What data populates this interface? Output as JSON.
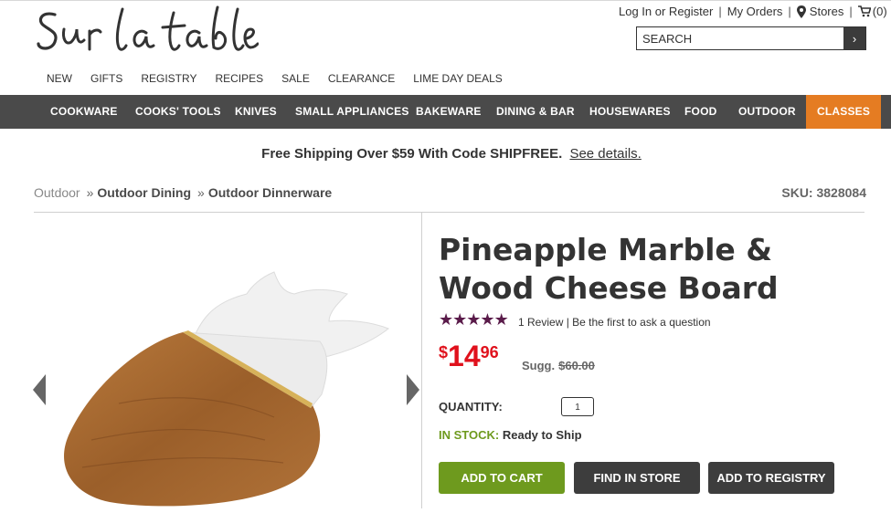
{
  "brand": {
    "logo_text": "Sur la table"
  },
  "utility": {
    "login": "Log In or Register",
    "orders": "My Orders",
    "stores": "Stores",
    "cart": "(0)"
  },
  "search": {
    "placeholder": "SEARCH"
  },
  "subnav": [
    "NEW",
    "GIFTS",
    "REGISTRY",
    "RECIPES",
    "SALE",
    "CLEARANCE",
    "LIME DAY DEALS"
  ],
  "mainnav": [
    "COOKWARE",
    "COOKS' TOOLS",
    "KNIVES",
    "SMALL APPLIANCES",
    "BAKEWARE",
    "DINING & BAR",
    "HOUSEWARES",
    "FOOD",
    "OUTDOOR",
    "CLASSES"
  ],
  "promo": {
    "text": "Free Shipping Over $59 With Code SHIPFREE.",
    "link": "See details."
  },
  "breadcrumb": [
    "Outdoor",
    "Outdoor Dining",
    "Outdoor Dinnerware"
  ],
  "sku": "SKU: 3828084",
  "product": {
    "title": "Pineapple Marble & Wood Cheese Board",
    "rating": 5,
    "review_text": "1 Review | Be the first to ask a question",
    "price_currency": "$",
    "price_dollars": "14",
    "price_cents": "96",
    "sugg_label": "Sugg.",
    "sugg_price": "$60.00",
    "quantity_label": "QUANTITY:",
    "quantity": "1",
    "stock_label": "IN STOCK:",
    "stock_status": "Ready to Ship"
  },
  "buttons": {
    "add_to_cart": "ADD TO CART",
    "find_in_store": "FIND IN STORE",
    "add_to_registry": "ADD TO REGISTRY"
  },
  "colors": {
    "accent": "#e57c22",
    "nav_bg": "#4a4a4a",
    "green": "#6e9a1e",
    "price_red": "#e0111c",
    "star": "#5a1b4a"
  }
}
